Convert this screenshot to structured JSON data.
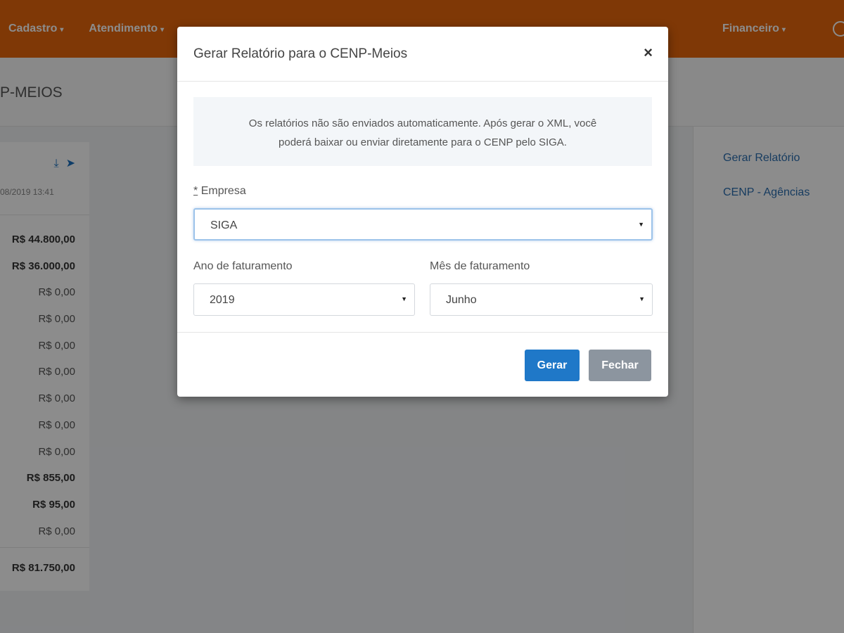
{
  "nav": {
    "items": [
      {
        "label": "Cadastro",
        "caret": "▾"
      },
      {
        "label": "Atendimento",
        "caret": "▾"
      },
      {
        "label": "Financeiro",
        "caret": "▾"
      }
    ]
  },
  "page": {
    "title": "P-MEIOS"
  },
  "left_card": {
    "date": "08/2019 13:41",
    "icon_download": "⤓",
    "icon_send": "➤",
    "amounts": [
      {
        "value": "R$ 44.800,00"
      },
      {
        "value": "R$ 36.000,00"
      },
      {
        "value": "R$ 0,00"
      },
      {
        "value": "R$ 0,00"
      },
      {
        "value": "R$ 0,00"
      },
      {
        "value": "R$ 0,00"
      },
      {
        "value": "R$ 0,00"
      },
      {
        "value": "R$ 0,00"
      },
      {
        "value": "R$ 0,00"
      },
      {
        "value": "R$ 855,00"
      },
      {
        "value": "R$ 95,00"
      },
      {
        "value": "R$ 0,00"
      }
    ],
    "total": "R$ 81.750,00"
  },
  "sidebar": {
    "items": [
      {
        "label": "Gerar Relatório"
      },
      {
        "label": "CENP - Agências"
      }
    ]
  },
  "modal": {
    "title": "Gerar Relatório para o CENP-Meios",
    "close": "×",
    "info_line1": "Os relatórios não são enviados automaticamente. Após gerar o XML, você",
    "info_line2": "poderá baixar ou enviar diretamente para o CENP pelo SIGA.",
    "empresa_required": "*",
    "empresa_label": "Empresa",
    "empresa_value": "SIGA",
    "ano_label": "Ano de faturamento",
    "ano_value": "2019",
    "mes_label": "Mês de faturamento",
    "mes_value": "Junho",
    "select_arrow": "▼",
    "gerar_label": "Gerar",
    "fechar_label": "Fechar"
  }
}
